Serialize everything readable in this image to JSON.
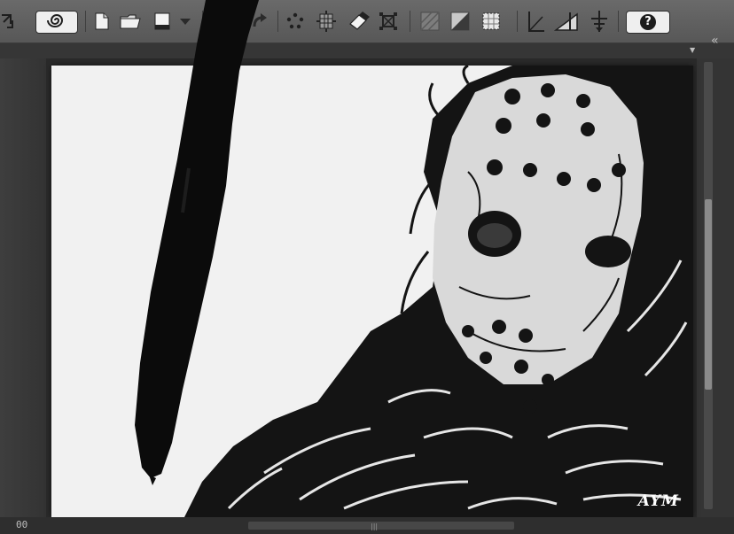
{
  "toolbar": {
    "tools": [
      {
        "icon": "transform-icon"
      },
      {
        "icon": "spiral-icon"
      },
      {
        "icon": "new-file-icon"
      },
      {
        "icon": "open-folder-icon"
      },
      {
        "icon": "canvas-color-icon"
      },
      {
        "icon": "dropdown-arrow-icon"
      },
      {
        "icon": "redo-icon"
      },
      {
        "icon": "dots-icon"
      },
      {
        "icon": "grid-icon"
      },
      {
        "icon": "eraser-icon"
      },
      {
        "icon": "crop-icon"
      },
      {
        "icon": "pattern-icon"
      },
      {
        "icon": "half-fill-icon"
      },
      {
        "icon": "selection-grid-icon"
      },
      {
        "icon": "ruler-icon"
      },
      {
        "icon": "perspective-ruler-icon"
      },
      {
        "icon": "align-icon"
      },
      {
        "icon": "help-icon"
      }
    ],
    "help_symbol": "?"
  },
  "subbar": {
    "collapse_glyph": "«",
    "right_dropdown_glyph": "▼"
  },
  "status": {
    "zoom_text": "00"
  },
  "canvas": {
    "signature": "AYM",
    "colors": {
      "paper": "#f1f1f1",
      "ink": "#141414"
    }
  }
}
